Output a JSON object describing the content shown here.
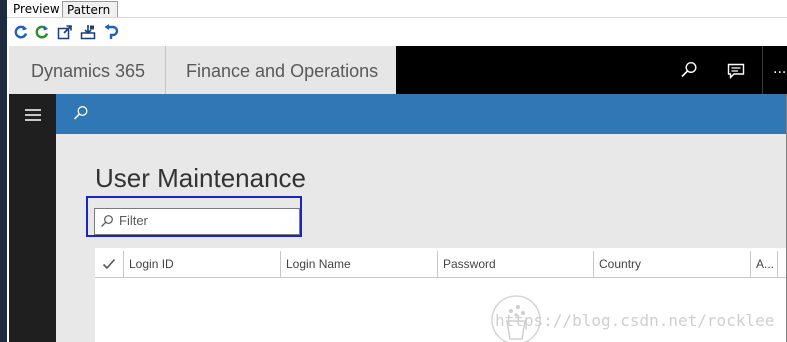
{
  "designer": {
    "tabs": [
      {
        "label": "Preview"
      },
      {
        "label": "Pattern"
      }
    ],
    "toolbar": {
      "icons": [
        "refresh-icon",
        "refresh-green-icon",
        "open-external-icon",
        "save-export-icon",
        "undo-icon"
      ]
    }
  },
  "header": {
    "app_name": "Dynamics 365",
    "module_name": "Finance and Operations",
    "search_icon": "search-icon",
    "feedback_icon": "chat-icon",
    "more_label": "..."
  },
  "nav": {
    "menu_icon": "hamburger-icon"
  },
  "actionbar": {
    "search_icon": "search-icon"
  },
  "page": {
    "title": "User Maintenance",
    "filter_placeholder": "Filter"
  },
  "grid": {
    "columns": [
      "Login ID",
      "Login Name",
      "Password",
      "Country",
      "A..."
    ]
  },
  "watermark": {
    "text": "https://blog.csdn.net/rocklee"
  },
  "colors": {
    "header_bg": "#e6e6e6",
    "header_dark": "#000000",
    "accent_blue": "#2f78b5",
    "nav_dark": "#1f1f1f",
    "highlight_outline": "#1a24c9"
  }
}
